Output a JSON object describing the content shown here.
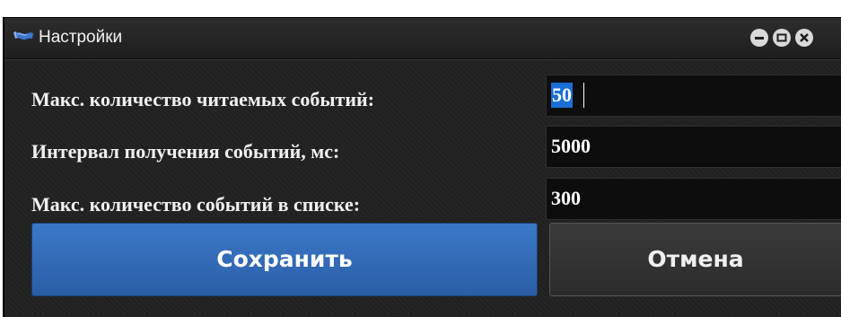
{
  "window": {
    "title": "Настройки",
    "icon": "flag-icon",
    "controls": [
      "minimize-icon",
      "maximize-icon",
      "close-icon"
    ]
  },
  "settings": {
    "max_read_events": {
      "label": "Макс. количество читаемых событий:",
      "value": "50"
    },
    "poll_interval": {
      "label": "Интервал получения событий, мс:",
      "value": "5000"
    },
    "max_list_events": {
      "label": "Макс. количество событий в списке:",
      "value": "300"
    }
  },
  "buttons": {
    "save_label": "Сохранить",
    "cancel_label": "Отмена"
  },
  "colors": {
    "accent": "#2f6bbd",
    "selection": "#1a6fd6",
    "background": "#202020",
    "field_background": "#0d0d0d"
  }
}
